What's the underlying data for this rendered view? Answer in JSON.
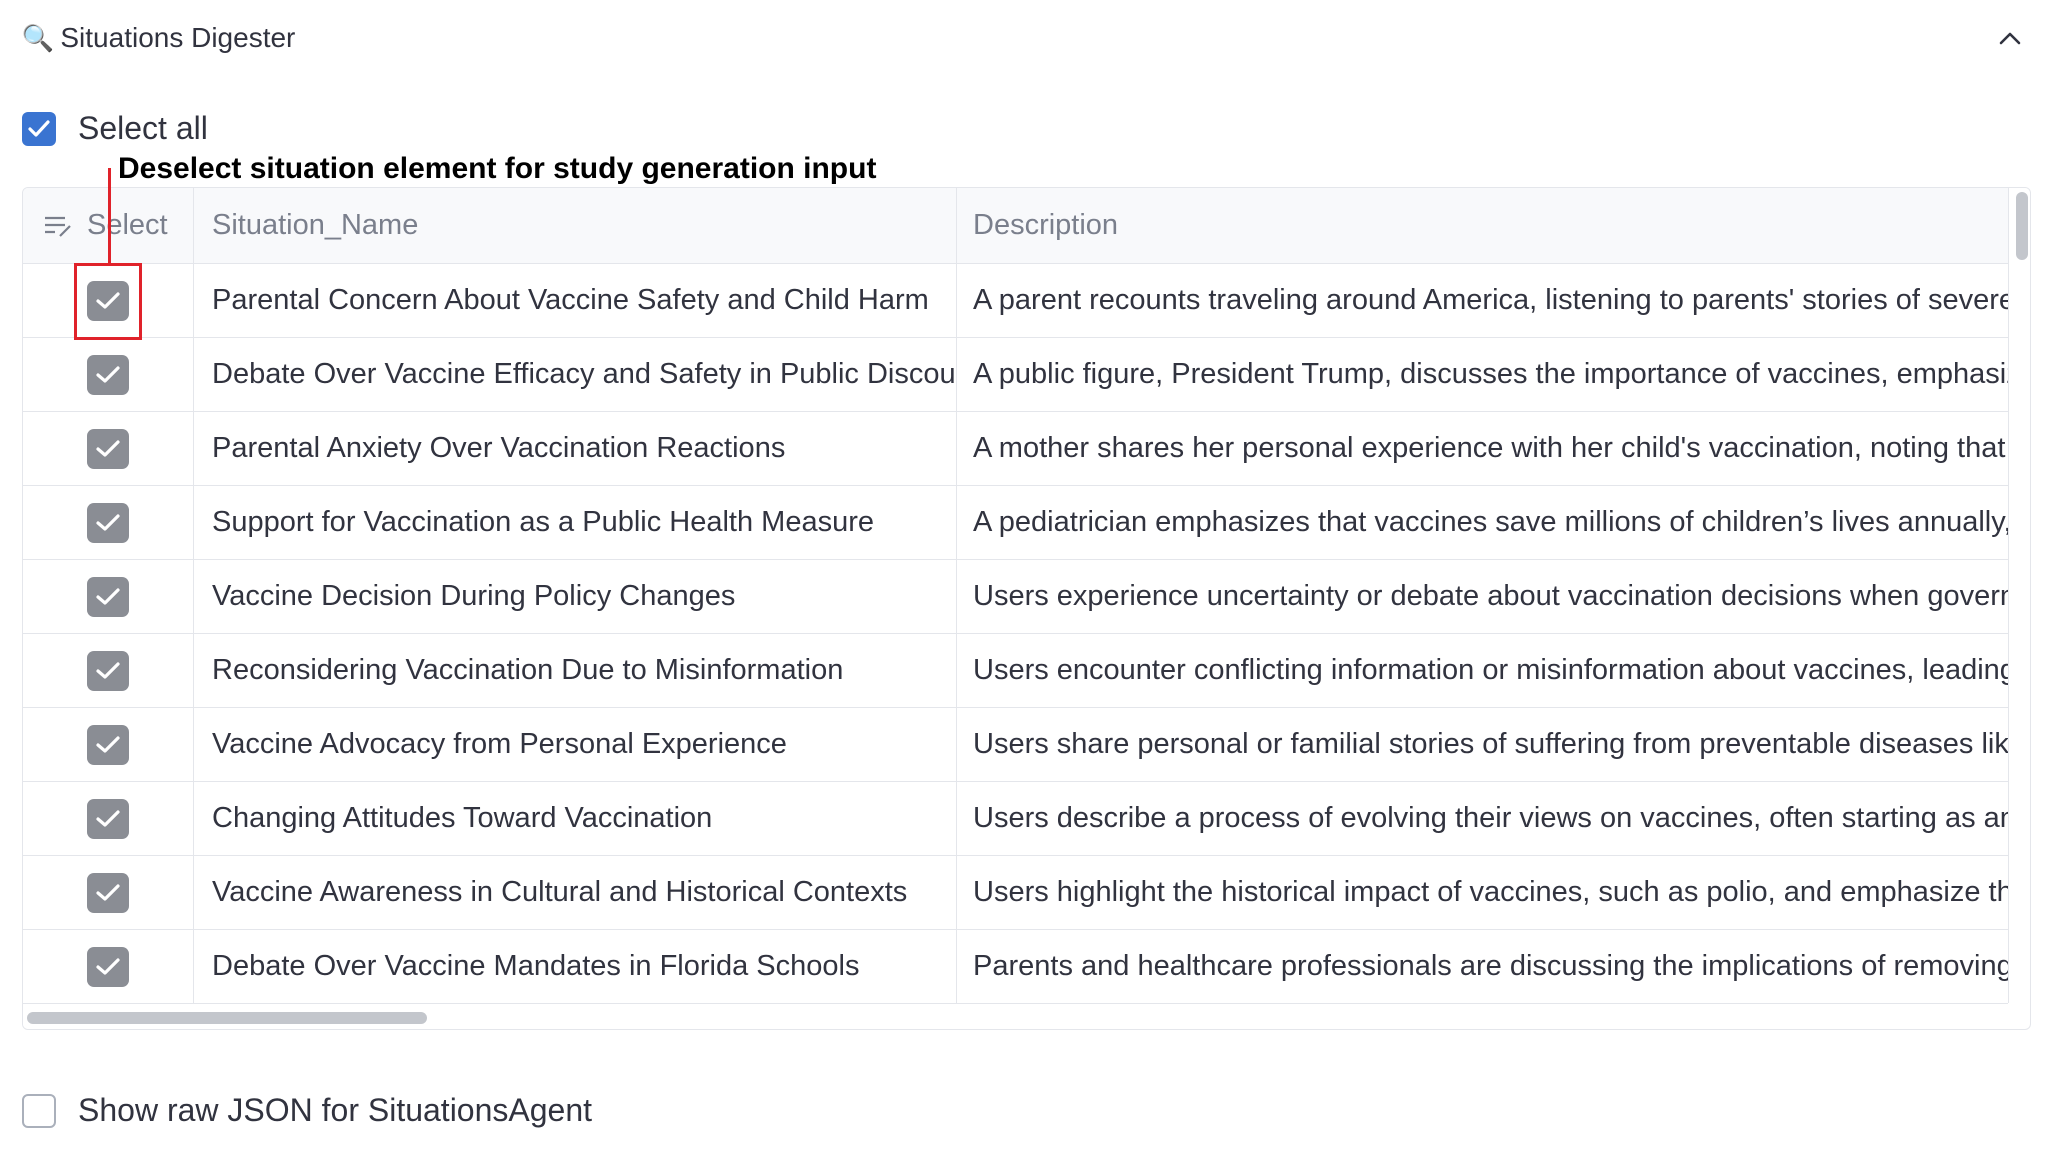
{
  "header": {
    "icon": "magnifier-icon",
    "title": "Situations Digester"
  },
  "select_all": {
    "label": "Select all",
    "checked": true
  },
  "annotation": {
    "text": "Deselect situation element for study generation input",
    "color": "#e0222a"
  },
  "table": {
    "columns": [
      "Select",
      "Situation_Name",
      "Description"
    ],
    "rows": [
      {
        "checked": true,
        "name": "Parental Concern About Vaccine Safety and Child Harm",
        "description": "A parent recounts traveling around America, listening to parents' stories of severe adverse"
      },
      {
        "checked": true,
        "name": "Debate Over Vaccine Efficacy and Safety in Public Discourse",
        "description": "A public figure, President Trump, discusses the importance of vaccines, emphasizing"
      },
      {
        "checked": true,
        "name": "Parental Anxiety Over Vaccination Reactions",
        "description": "A mother shares her personal experience with her child's vaccination, noting that her"
      },
      {
        "checked": true,
        "name": "Support for Vaccination as a Public Health Measure",
        "description": "A pediatrician emphasizes that vaccines save millions of children’s lives annually, advocating"
      },
      {
        "checked": true,
        "name": "Vaccine Decision During Policy Changes",
        "description": "Users experience uncertainty or debate about vaccination decisions when government"
      },
      {
        "checked": true,
        "name": "Reconsidering Vaccination Due to Misinformation",
        "description": "Users encounter conflicting information or misinformation about vaccines, leading some"
      },
      {
        "checked": true,
        "name": "Vaccine Advocacy from Personal Experience",
        "description": "Users share personal or familial stories of suffering from preventable diseases like polio"
      },
      {
        "checked": true,
        "name": "Changing Attitudes Toward Vaccination",
        "description": "Users describe a process of evolving their views on vaccines, often starting as antivaxxers"
      },
      {
        "checked": true,
        "name": "Vaccine Awareness in Cultural and Historical Contexts",
        "description": "Users highlight the historical impact of vaccines, such as polio, and emphasize the importance"
      },
      {
        "checked": true,
        "name": "Debate Over Vaccine Mandates in Florida Schools",
        "description": "Parents and healthcare professionals are discussing the implications of removing vaccine"
      }
    ]
  },
  "raw_json": {
    "label": "Show raw JSON for SituationsAgent",
    "checked": false
  },
  "colors": {
    "accent": "#3a74d1",
    "row_checkbox": "#8a8d94",
    "annotation": "#e0222a"
  }
}
